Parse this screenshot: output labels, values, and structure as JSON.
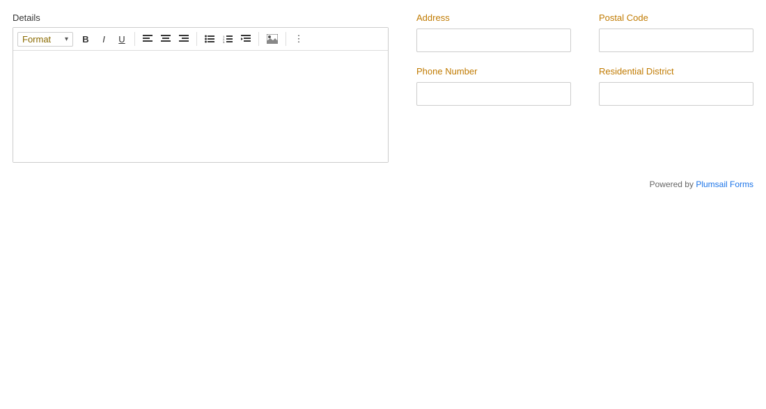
{
  "details": {
    "label": "Details",
    "toolbar": {
      "format_label": "Format",
      "bold_label": "B",
      "italic_label": "I",
      "underline_label": "U",
      "more_options_label": "⋮"
    }
  },
  "form": {
    "address": {
      "label": "Address",
      "placeholder": ""
    },
    "postal_code": {
      "label": "Postal Code",
      "placeholder": ""
    },
    "phone_number": {
      "label": "Phone Number",
      "placeholder": ""
    },
    "residential_district": {
      "label": "Residential District",
      "placeholder": ""
    }
  },
  "footer": {
    "powered_by_text": "Powered by ",
    "powered_by_link": "Plumsail Forms"
  }
}
